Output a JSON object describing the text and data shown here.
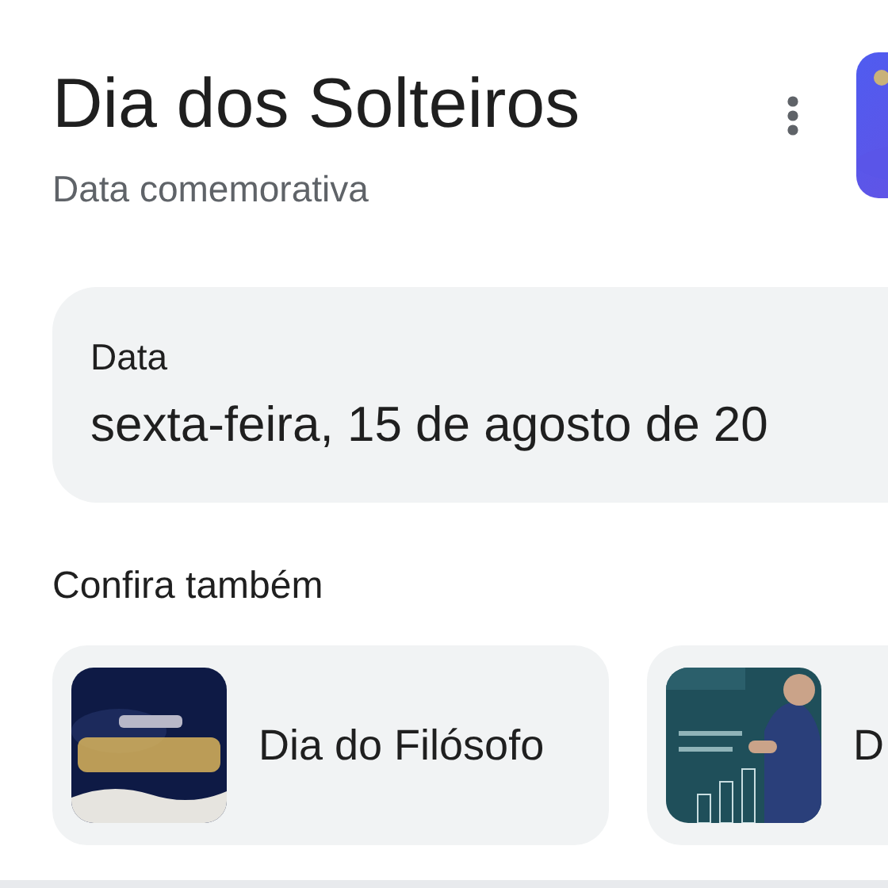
{
  "header": {
    "title": "Dia dos Solteiros",
    "subtitle": "Data comemorativa"
  },
  "date_card": {
    "label": "Data",
    "value": "sexta-feira, 15 de agosto de 20"
  },
  "related": {
    "heading": "Confira também",
    "items": [
      {
        "title": "Dia do Filósofo"
      },
      {
        "title": "D"
      }
    ]
  }
}
